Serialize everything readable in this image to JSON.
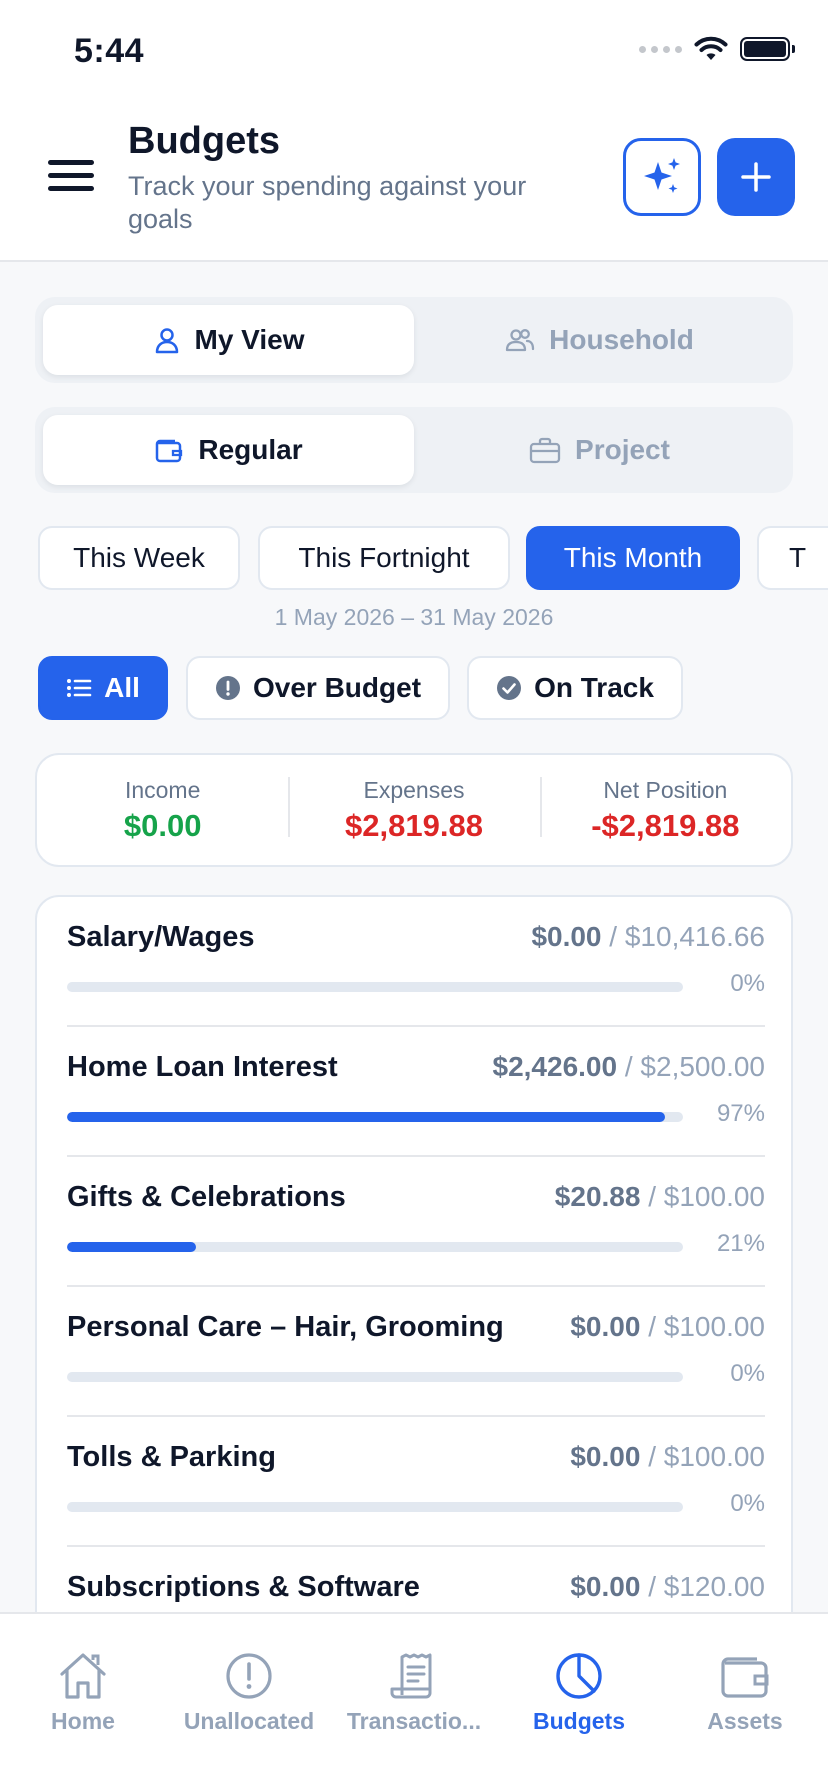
{
  "status_bar": {
    "time": "5:44"
  },
  "header": {
    "title": "Budgets",
    "subtitle": "Track your spending against your goals"
  },
  "view_toggle": {
    "options": [
      {
        "label": "My View",
        "icon": "user-icon",
        "selected": true
      },
      {
        "label": "Household",
        "icon": "users-icon",
        "selected": false
      }
    ]
  },
  "type_toggle": {
    "options": [
      {
        "label": "Regular",
        "icon": "wallet-icon",
        "selected": true
      },
      {
        "label": "Project",
        "icon": "briefcase-icon",
        "selected": false
      }
    ]
  },
  "periods": {
    "options": [
      {
        "label": "This Week",
        "selected": false
      },
      {
        "label": "This Fortnight",
        "selected": false
      },
      {
        "label": "This Month",
        "selected": true
      },
      {
        "label": "T",
        "selected": false
      }
    ],
    "date_range": "1 May 2026 – 31 May 2026"
  },
  "filters": {
    "options": [
      {
        "label": "All",
        "icon": "list-icon",
        "selected": true
      },
      {
        "label": "Over Budget",
        "icon": "alert-circle-icon",
        "selected": false
      },
      {
        "label": "On Track",
        "icon": "check-circle-icon",
        "selected": false
      }
    ]
  },
  "summary": {
    "income": {
      "label": "Income",
      "value": "$0.00"
    },
    "expenses": {
      "label": "Expenses",
      "value": "$2,819.88"
    },
    "net": {
      "label": "Net Position",
      "value": "-$2,819.88"
    }
  },
  "budgets": [
    {
      "name": "Salary/Wages",
      "spent": "$0.00",
      "sep": "/",
      "limit": "$10,416.66",
      "percent_label": "0%",
      "progress": 0
    },
    {
      "name": "Home Loan Interest",
      "spent": "$2,426.00",
      "sep": "/",
      "limit": "$2,500.00",
      "percent_label": "97%",
      "progress": 0.97
    },
    {
      "name": "Gifts & Celebrations",
      "spent": "$20.88",
      "sep": "/",
      "limit": "$100.00",
      "percent_label": "21%",
      "progress": 0.21
    },
    {
      "name": "Personal Care – Hair, Grooming",
      "spent": "$0.00",
      "sep": "/",
      "limit": "$100.00",
      "percent_label": "0%",
      "progress": 0
    },
    {
      "name": "Tolls & Parking",
      "spent": "$0.00",
      "sep": "/",
      "limit": "$100.00",
      "percent_label": "0%",
      "progress": 0
    },
    {
      "name": "Subscriptions & Software",
      "spent": "$0.00",
      "sep": "/",
      "limit": "$120.00",
      "percent_label": "",
      "progress": 0
    }
  ],
  "tabbar": {
    "items": [
      {
        "label": "Home",
        "icon": "home-icon",
        "active": false
      },
      {
        "label": "Unallocated",
        "icon": "alert-circle-icon",
        "active": false
      },
      {
        "label": "Transactio...",
        "icon": "receipt-icon",
        "active": false
      },
      {
        "label": "Budgets",
        "icon": "pie-chart-icon",
        "active": true
      },
      {
        "label": "Assets",
        "icon": "wallet-icon",
        "active": false
      }
    ]
  },
  "colors": {
    "accent": "#2563eb",
    "income": "#16a34a",
    "negative": "#dc2626",
    "muted": "#94a3b8"
  }
}
